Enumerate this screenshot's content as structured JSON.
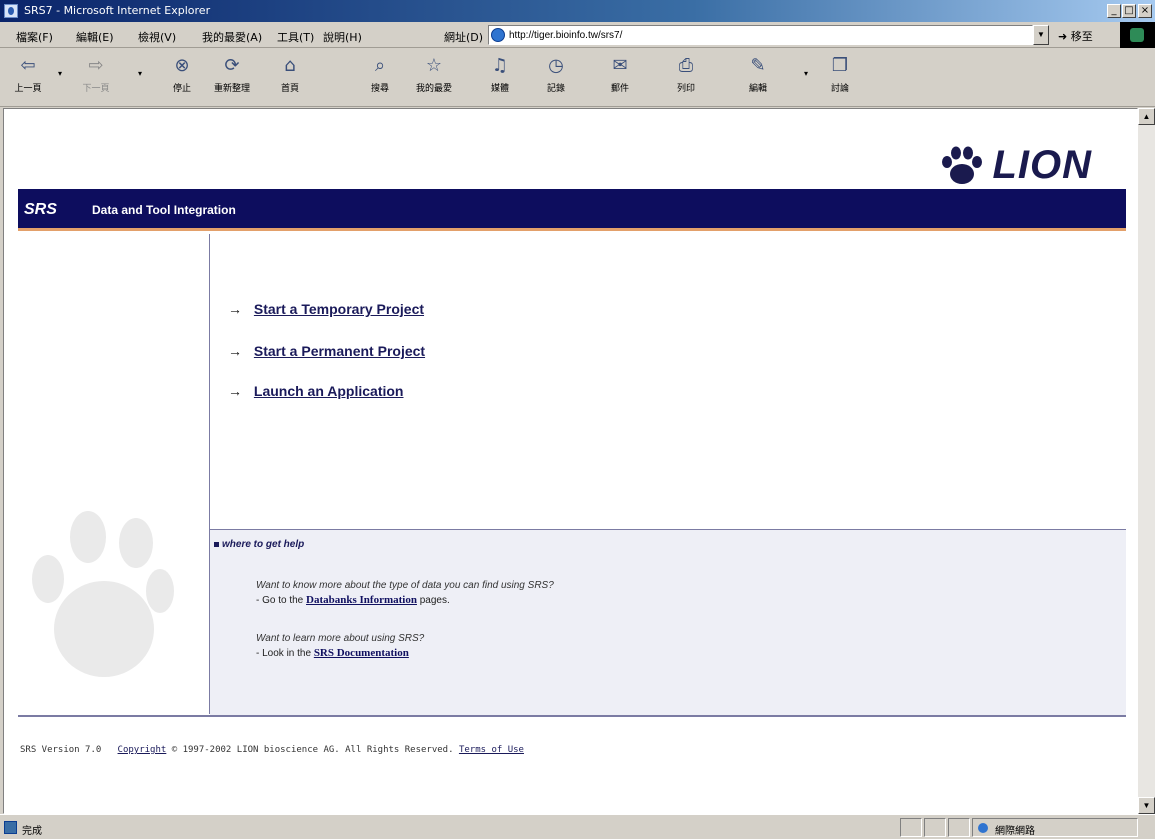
{
  "window": {
    "title": "SRS7 - Microsoft Internet Explorer",
    "minimize": "_",
    "maximize": "□",
    "close": "×"
  },
  "menu": {
    "items": [
      "檔案(F)",
      "編輯(E)",
      "檢視(V)",
      "我的最愛(A)",
      "工具(T)",
      "說明(H)"
    ]
  },
  "address": {
    "label": "網址(D)",
    "url": "http://tiger.bioinfo.tw/srs7/",
    "go_label": "移至"
  },
  "toolbar": {
    "buttons": [
      {
        "label": "上一頁",
        "icon": "back-arrow-icon"
      },
      {
        "label": "下一頁",
        "icon": "forward-arrow-icon"
      },
      {
        "label": "停止",
        "icon": "stop-icon"
      },
      {
        "label": "重新整理",
        "icon": "refresh-icon"
      },
      {
        "label": "首頁",
        "icon": "home-icon"
      },
      {
        "label": "搜尋",
        "icon": "search-icon"
      },
      {
        "label": "我的最愛",
        "icon": "favorites-icon"
      },
      {
        "label": "媒體",
        "icon": "media-icon"
      },
      {
        "label": "記錄",
        "icon": "history-icon"
      },
      {
        "label": "郵件",
        "icon": "mail-icon"
      },
      {
        "label": "列印",
        "icon": "print-icon"
      },
      {
        "label": "編輯",
        "icon": "edit-icon"
      },
      {
        "label": "討論",
        "icon": "discuss-icon"
      }
    ]
  },
  "page": {
    "brand": "LION",
    "banner_title": "SRS",
    "banner_subtitle": "Data and Tool Integration",
    "actions": [
      {
        "label": "Start a Temporary Project"
      },
      {
        "label": "Start a Permanent Project"
      },
      {
        "label": "Launch an Application"
      }
    ],
    "help": {
      "heading": "where to get help",
      "q1": "Want to know more about the type of data you can find using SRS?",
      "a1_prefix": "- Go to the ",
      "a1_link": "Databanks Information",
      "a1_suffix": " pages.",
      "q2": "Want to learn more about using SRS?",
      "a2_prefix": "- Look in the ",
      "a2_link": "SRS Documentation"
    },
    "footer": {
      "version": "SRS Version 7.0",
      "copyright_link": "Copyright",
      "copyright_text": "© 1997-2002 LION bioscience AG. All Rights Reserved.",
      "terms_link": "Terms of Use"
    }
  },
  "status": {
    "text": "完成",
    "zone": "網際網路"
  },
  "colors": {
    "banner": "#0d0d5e",
    "banner_accent": "#e3a06a",
    "link": "#1a1a5a",
    "help_bg": "#eeeff6"
  }
}
